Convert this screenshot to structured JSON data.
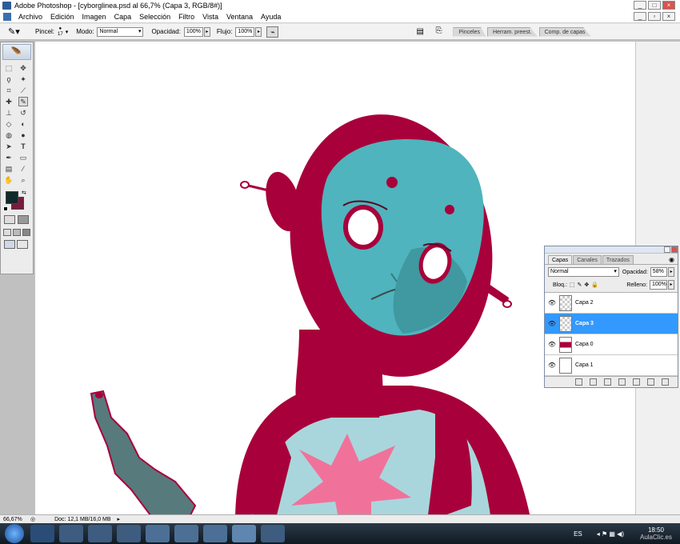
{
  "window": {
    "title": "Adobe Photoshop - [cyborglinea.psd al 66,7% (Capa 3, RGB/8#)]",
    "controls": [
      "_",
      "□",
      "×"
    ],
    "doc_controls": [
      "_",
      "▫",
      "×"
    ]
  },
  "menu": [
    "Archivo",
    "Edición",
    "Imagen",
    "Capa",
    "Selección",
    "Filtro",
    "Vista",
    "Ventana",
    "Ayuda"
  ],
  "options": {
    "pincel_label": "Pincel:",
    "brush_size": "17",
    "modo_label": "Modo:",
    "modo_value": "Normal",
    "opacidad_label": "Opacidad:",
    "opacidad_value": "100%",
    "flujo_label": "Flujo:",
    "flujo_value": "100%",
    "panel_tabs": [
      "Pinceles",
      "Herram. preest.",
      "Comp. de capas"
    ]
  },
  "colors": {
    "foreground": "#0f2a2c",
    "background": "#7a1b3a",
    "crimson": "#a8003a",
    "teal": "#4fb4bd",
    "pale_blue": "#a9d6dc",
    "pink": "#f0729a",
    "gun_gray": "#577a7d",
    "selection": "#3399ff"
  },
  "layers_panel": {
    "tabs": [
      "Capas",
      "Canales",
      "Trazados"
    ],
    "blend_mode": "Normal",
    "opacidad_label": "Opacidad:",
    "opacidad_value": "58%",
    "bloq_label": "Bloq.:",
    "relleno_label": "Relleno:",
    "relleno_value": "100%",
    "layers": [
      {
        "name": "Capa 2",
        "selected": false
      },
      {
        "name": "Capa 3",
        "selected": true
      },
      {
        "name": "Capa 0",
        "selected": false
      },
      {
        "name": "Capa 1",
        "selected": false
      }
    ]
  },
  "status": {
    "zoom": "66,67%",
    "doc": "Doc: 12,1 MB/16,0 MB"
  },
  "taskbar": {
    "lang": "ES",
    "time": "18:50",
    "watermark": "AulaClic.es"
  }
}
